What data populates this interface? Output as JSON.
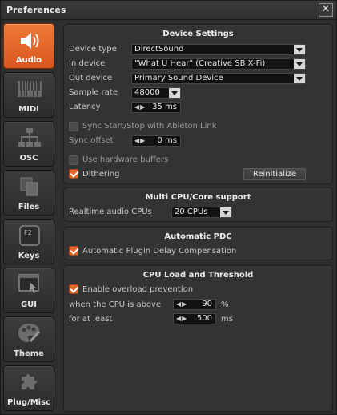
{
  "window": {
    "title": "Preferences",
    "close_glyph": "✕"
  },
  "sidebar": {
    "items": [
      {
        "label": "Audio",
        "icon": "speaker-icon",
        "active": true
      },
      {
        "label": "MIDI",
        "icon": "piano-keys-icon"
      },
      {
        "label": "OSC",
        "icon": "network-tree-icon"
      },
      {
        "label": "Files",
        "icon": "files-icon"
      },
      {
        "label": "Keys",
        "icon": "keyboard-key-icon",
        "key_glyph": "F2"
      },
      {
        "label": "GUI",
        "icon": "window-cursor-icon"
      },
      {
        "label": "Theme",
        "icon": "palette-icon"
      },
      {
        "label": "Plug/Misc",
        "icon": "puzzle-icon"
      }
    ]
  },
  "device_settings": {
    "title": "Device Settings",
    "device_type_label": "Device type",
    "device_type_value": "DirectSound",
    "in_device_label": "In device",
    "in_device_value": "\"What U Hear\" (Creative SB X-Fi)",
    "out_device_label": "Out device",
    "out_device_value": "Primary Sound Device",
    "sample_rate_label": "Sample rate",
    "sample_rate_value": "48000",
    "latency_label": "Latency",
    "latency_value": "35 ms",
    "sync_link_label": "Sync Start/Stop with Ableton Link",
    "sync_offset_label": "Sync offset",
    "sync_offset_value": "0 ms",
    "hw_buffers_label": "Use hardware buffers",
    "dithering_label": "Dithering",
    "reinitialize_label": "Reinitialize"
  },
  "multi_cpu": {
    "title": "Multi CPU/Core support",
    "cpus_label": "Realtime audio CPUs",
    "cpus_value": "20 CPUs"
  },
  "auto_pdc": {
    "title": "Automatic PDC",
    "compensation_label": "Automatic Plugin Delay Compensation"
  },
  "cpu_load": {
    "title": "CPU Load and Threshold",
    "overload_label": "Enable overload prevention",
    "above_label": "when the CPU is above",
    "above_value": "90",
    "above_unit": "%",
    "atleast_label": "for at least",
    "atleast_value": "500",
    "atleast_unit": "ms"
  },
  "spin_arrows": "◀▶",
  "colors": {
    "accent": "#e0672a",
    "panel": "#333333",
    "field": "#121212"
  }
}
